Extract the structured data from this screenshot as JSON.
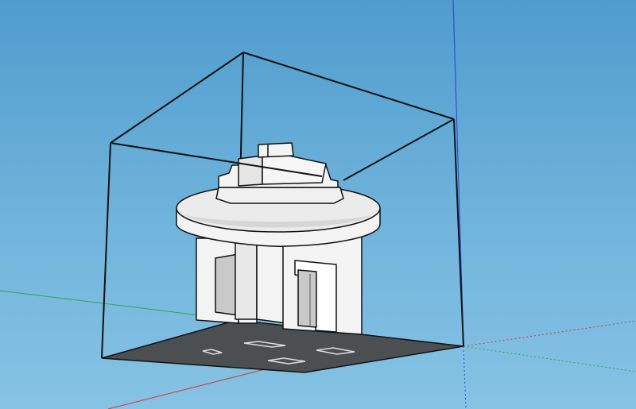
{
  "viewport": {
    "kind": "3d-modeling-viewport",
    "sky_top": "#4f9ccd",
    "sky_bottom": "#86c3e4"
  },
  "axes": {
    "red": "#d23a3a",
    "green": "#2ea84a",
    "blue": "#2a4fd8"
  },
  "model": {
    "bounding_box_color": "#111111",
    "body_color": "#f4f4f4",
    "shade_color": "#c9c9c9",
    "floor_color": "#4b4f52"
  }
}
